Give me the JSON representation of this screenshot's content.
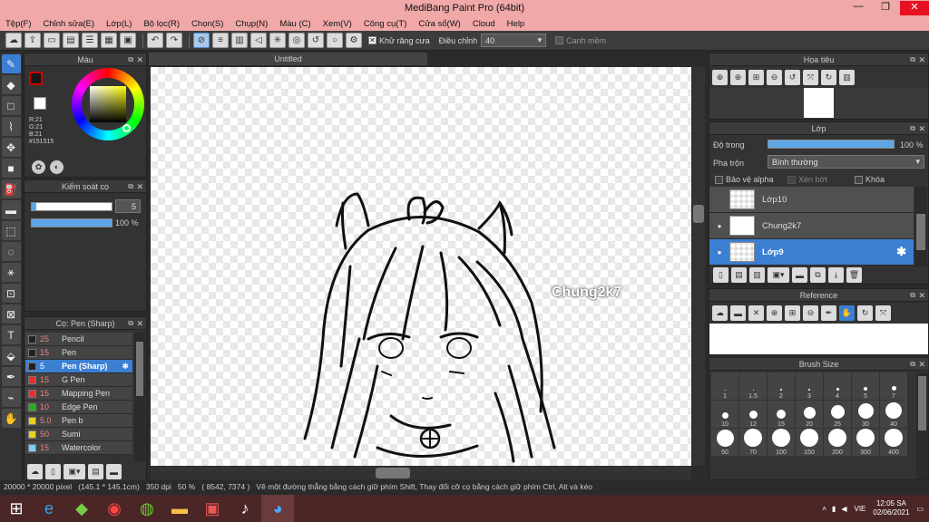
{
  "title": "MediBang Paint Pro (64bit)",
  "window_controls": {
    "minimize": "—",
    "maximize": "❐",
    "close": "✕"
  },
  "menu": [
    "Tệp(F)",
    "Chỉnh sửa(E)",
    "Lớp(L)",
    "Bộ lọc(R)",
    "Chọn(S)",
    "Chụp(N)",
    "Màu (C)",
    "Xem(V)",
    "Công cụ(T)",
    "Cửa sổ(W)",
    "Cloud",
    "Help"
  ],
  "toolbar": {
    "antialias_label": "Khử răng cưa",
    "antialias_checked": "✕",
    "adjust_label": "Điều chỉnh",
    "adjust_value": "40",
    "snap_label": "Canh mềm"
  },
  "color_panel": {
    "title": "Màu",
    "r": "R:21",
    "g": "G:21",
    "b": "B:21",
    "hex": "#151515"
  },
  "brush_control": {
    "title": "Kiểm soát cọ",
    "size": "5",
    "opacity": "100 %"
  },
  "brush_panel": {
    "title": "Cọ: Pen (Sharp)",
    "brushes": [
      {
        "size": "25",
        "name": "Pencil",
        "color": "#222222"
      },
      {
        "size": "15",
        "name": "Pen",
        "color": "#222222"
      },
      {
        "size": "5",
        "name": "Pen (Sharp)",
        "color": "#222222"
      },
      {
        "size": "15",
        "name": "G Pen",
        "color": "#e53030"
      },
      {
        "size": "15",
        "name": "Mapping Pen",
        "color": "#e53030"
      },
      {
        "size": "10",
        "name": "Edge Pen",
        "color": "#20b020"
      },
      {
        "size": "5.0",
        "name": "Pen b",
        "color": "#e8d020"
      },
      {
        "size": "50",
        "name": "Sumi",
        "color": "#e8d020"
      },
      {
        "size": "15",
        "name": "Watercolor",
        "color": "#7ad0f0"
      }
    ]
  },
  "canvas": {
    "tab": "Untitled",
    "watermark": "Chung2k7"
  },
  "navigator": {
    "title": "Họa tiêu"
  },
  "layer_panel": {
    "title": "Lớp",
    "opacity_label": "Độ trong",
    "opacity_value": "100 %",
    "blend_label": "Pha trộn",
    "blend_value": "Bình thường",
    "protect_alpha": "Bảo vệ alpha",
    "clip": "Xén bớt",
    "lock": "Khóa",
    "layers": [
      {
        "name": "Lớp10"
      },
      {
        "name": "Chung2k7"
      },
      {
        "name": "Lớp9"
      }
    ]
  },
  "reference": {
    "title": "Reference"
  },
  "brush_size": {
    "title": "Brush Size",
    "sizes": [
      "1",
      "1.5",
      "2",
      "3",
      "4",
      "5",
      "7",
      "10",
      "12",
      "15",
      "20",
      "25",
      "30",
      "40",
      "50",
      "70",
      "100",
      "150",
      "200",
      "300",
      "400"
    ]
  },
  "status": {
    "size": "20000 * 20000 pixel",
    "cm": "(145.1 * 145.1cm)",
    "dpi": "350 dpi",
    "zoom": "50 %",
    "coords": "( 8542, 7374 )",
    "hint": "Vẽ một đường thẳng bằng cách giữ phím Shift, Thay đổi cỡ cọ bằng cách giữ phím Ctrl, Alt và kéo"
  },
  "taskbar": {
    "lang": "VIE",
    "time": "12:05 SA",
    "date": "02/06/2021"
  }
}
